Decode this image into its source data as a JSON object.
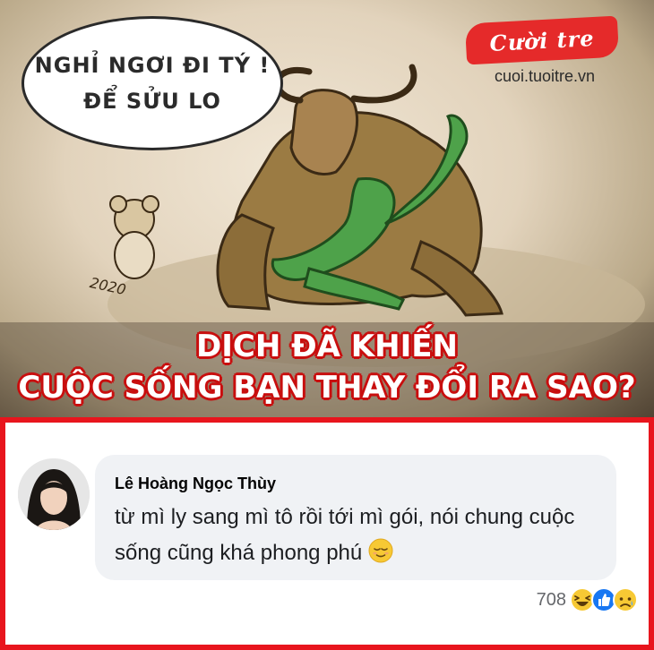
{
  "cartoon": {
    "speech_lines": [
      "NGHỈ NGƠI ĐI TÝ !",
      "ĐỂ SỬU LO"
    ],
    "brand_logo": "Cười tre",
    "brand_url": "cuoi.tuoitre.vn",
    "floor_text_left": "2020",
    "headline_lines": [
      "DỊCH ĐÃ KHIẾN",
      "CUỘC SỐNG BẠN THAY ĐỔI RA SAO?"
    ]
  },
  "comment": {
    "author": "Lê Hoàng Ngọc Thùy",
    "text": "từ mì ly sang mì tô rồi tới mì gói, nói chung cuộc sống cũng khá phong phú",
    "trailing_emoji": "relieved-face-icon",
    "reaction_count": "708",
    "reactions": [
      "haha-icon",
      "like-icon",
      "sad-icon"
    ]
  },
  "colors": {
    "frame_red": "#e8151d",
    "headline_outline": "#c80e0e",
    "bubble_gray": "#f0f2f5",
    "like_blue": "#1877f2",
    "emoji_yellow": "#f7c934"
  }
}
